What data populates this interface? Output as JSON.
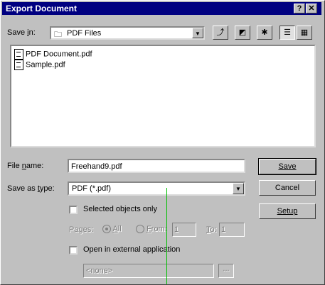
{
  "dialog": {
    "title": "Export Document",
    "help_btn": "?",
    "close_btn": "✕"
  },
  "toolbar": {
    "save_in_label_a": "Save ",
    "save_in_label_u": "i",
    "save_in_label_b": "n:",
    "folder_name": "PDF Files",
    "up_icon": "⤴",
    "desktop_icon": "◩",
    "new_folder_icon": "✱",
    "list_icon": "☰",
    "details_icon": "▦"
  },
  "files": [
    {
      "name": "PDF Document.pdf"
    },
    {
      "name": "Sample.pdf"
    }
  ],
  "form": {
    "file_name_label_a": "File ",
    "file_name_label_u": "n",
    "file_name_label_b": "ame:",
    "file_name_value": "Freehand9.pdf",
    "type_label_a": "Save as ",
    "type_label_u": "t",
    "type_label_b": "ype:",
    "type_value": "PDF (*.pdf)",
    "selected_only": "Selected objects only",
    "pages_label": "Pages:",
    "all_a": "",
    "all_u": "A",
    "all_b": "ll",
    "from_u": "F",
    "from_b": "rom:",
    "from_value": "1",
    "to_u": "T",
    "to_b": "o:",
    "to_value": "1",
    "open_external": "Open in external application",
    "app_value": "<none>",
    "browse_label": "..."
  },
  "buttons": {
    "save": "Save",
    "cancel": "Cancel",
    "setup": "Setup"
  },
  "colors": {
    "title_bar": "#000080",
    "face": "#c0c0c0",
    "cursor_line": "#00c000"
  }
}
